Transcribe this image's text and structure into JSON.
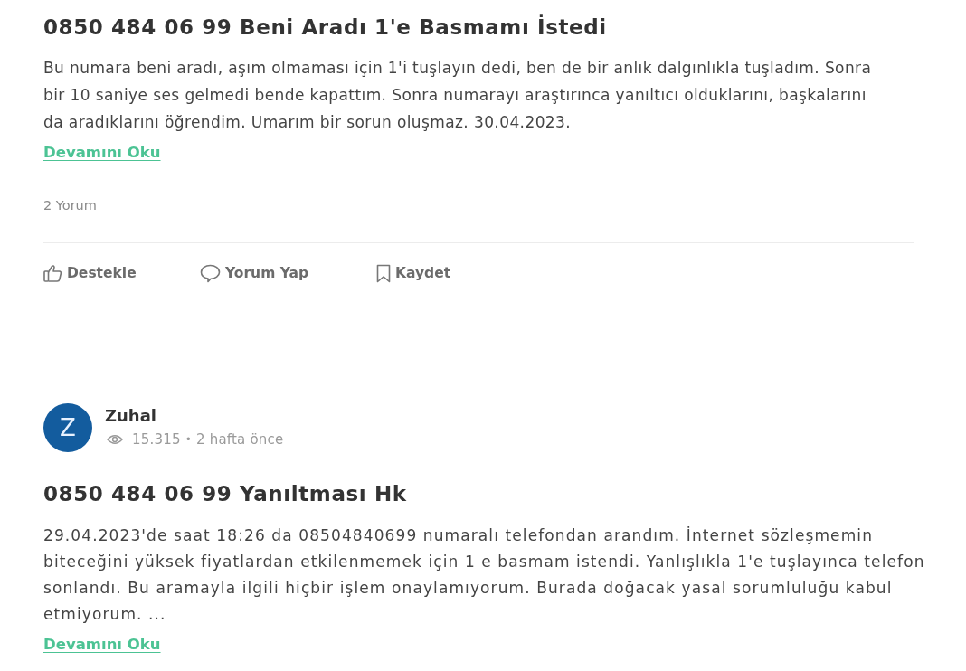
{
  "posts": [
    {
      "title": "0850 484 06 99 Beni Aradı 1'e Basmamı İstedi",
      "body": "Bu numara beni aradı, aşım olmaması için 1'i tuşlayın dedi, ben de bir anlık dalgınlıkla tuşladım. Sonra bir 10 saniye ses gelmedi bende kapattım. Sonra numarayı araştırınca yanıltıcı olduklarını, başkalarını da aradıklarını öğrendim. Umarım bir sorun oluşmaz. 30.04.2023.",
      "read_more": "Devamını Oku",
      "comment_count": "2 Yorum",
      "actions": [
        {
          "kind": "like",
          "label": "Destekle"
        },
        {
          "kind": "comment",
          "label": "Yorum Yap"
        },
        {
          "kind": "save",
          "label": "Kaydet"
        }
      ]
    },
    {
      "author": {
        "initial": "Z",
        "name": "Zuhal",
        "views": "15.315",
        "separator": "•",
        "time": "2 hafta önce"
      },
      "title": "0850 484 06 99 Yanıltması Hk",
      "body": "29.04.2023'de saat 18:26 da 08504840699 numaralı telefondan arandım. İnternet sözleşmemin biteceğini yüksek fiyatlardan etkilenmemek için 1 e basmam istendi. Yanlışlıkla 1'e tuşlayınca telefon sonlandı. Bu aramayla ilgili hiçbir işlem onaylamıyorum. Burada doğacak yasal sorumluluğu kabul etmiyorum. ...",
      "read_more": "Devamını Oku"
    }
  ]
}
